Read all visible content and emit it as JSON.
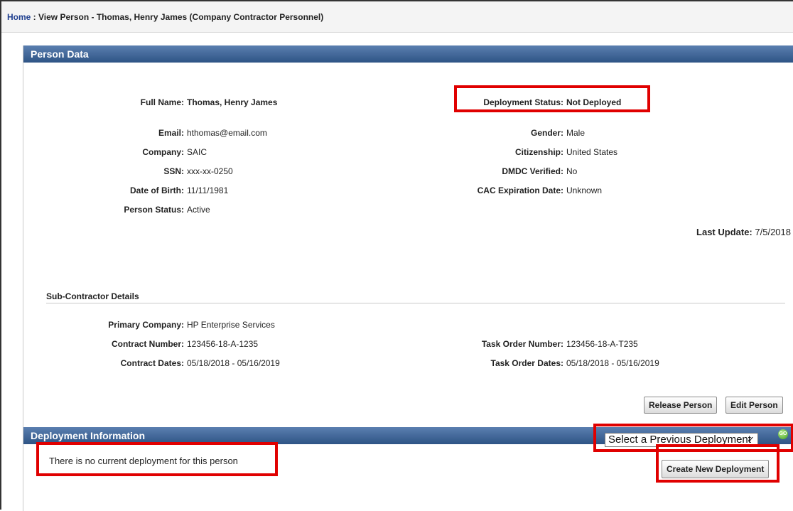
{
  "breadcrumb": {
    "home": "Home",
    "rest": " : View Person - Thomas, Henry James (Company Contractor Personnel)"
  },
  "person_section": {
    "title": "Person Data",
    "left_fields": [
      {
        "label": "Full Name:",
        "value": "Thomas, Henry James"
      },
      {
        "label": "Email:",
        "value": "hthomas@email.com"
      },
      {
        "label": "Company:",
        "value": "SAIC"
      },
      {
        "label": "SSN:",
        "value": "xxx-xx-0250"
      },
      {
        "label": "Date of Birth:",
        "value": "11/11/1981"
      },
      {
        "label": "Person Status:",
        "value": "Active"
      }
    ],
    "right_fields": [
      {
        "label": "Deployment Status:",
        "value": "Not Deployed"
      },
      {
        "label": "Gender:",
        "value": "Male"
      },
      {
        "label": "Citizenship:",
        "value": "United States"
      },
      {
        "label": "DMDC Verified:",
        "value": "No"
      },
      {
        "label": "CAC Expiration Date:",
        "value": "Unknown"
      }
    ],
    "last_update_label": "Last Update:",
    "last_update_value": "7/5/2018"
  },
  "subcontractor": {
    "title": "Sub-Contractor Details",
    "primary_company_label": "Primary Company:",
    "primary_company_value": "HP Enterprise Services",
    "contract_number_label": "Contract Number:",
    "contract_number_value": "123456-18-A-1235",
    "contract_dates_label": "Contract Dates:",
    "contract_dates_value": "05/18/2018 - 05/16/2019",
    "task_order_number_label": "Task Order Number:",
    "task_order_number_value": "123456-18-A-T235",
    "task_order_dates_label": "Task Order Dates:",
    "task_order_dates_value": "05/18/2018 - 05/16/2019"
  },
  "buttons": {
    "release_person": "Release Person",
    "edit_person": "Edit Person",
    "create_new_deployment": "Create New Deployment"
  },
  "deployment_section": {
    "title": "Deployment Information",
    "select_value": "Select a Previous Deployment",
    "go_icon_text": "GO",
    "no_deployment_message": "There is no current deployment for this person"
  },
  "colors": {
    "header_blue": "#2e5485",
    "highlight_red": "#e00000",
    "link_blue": "#1f3f8f"
  }
}
